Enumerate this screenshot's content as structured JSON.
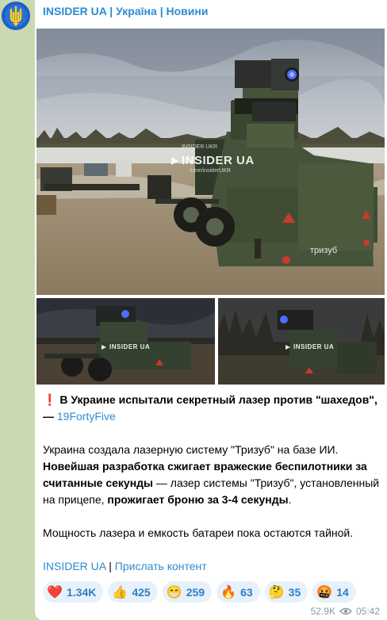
{
  "channel": {
    "header_name": "INSIDER UA",
    "header_tags": [
      "Україна",
      "Новини"
    ]
  },
  "media": {
    "watermark": "INSIDER UA",
    "watermark_top": "INSIDER UKR",
    "watermark_sub": "t.me/insiderUKR",
    "truck_label": "тризуб"
  },
  "post": {
    "headline": "В Украине испытали секретный лазер против \"шахедов\", —",
    "source_link": "19FortyFive",
    "p2_plain1": "Украина создала лазерную систему \"Тризуб\" на базе ИИ.",
    "p2_bold1": "Новейшая разработка сжигает вражеские беспилотники за считанные секунды",
    "p2_plain2": " — лазер системы \"Тризуб\", установленный на прицепе, ",
    "p2_bold2": "прожигает броню за 3-4 секунды",
    "p2_plain3": ".",
    "p3": "Мощность лазера и емкость батареи пока остаются тайной.",
    "footer_link1": "INSIDER UA",
    "footer_sep": "|",
    "footer_link2": "Прислать контент"
  },
  "reactions": [
    {
      "icon": "heart-icon",
      "emoji": "❤️",
      "count": "1.34K"
    },
    {
      "icon": "thumbs-up-icon",
      "emoji": "👍",
      "count": "425"
    },
    {
      "icon": "grin-face-icon",
      "emoji": "😁",
      "count": "259"
    },
    {
      "icon": "fire-icon",
      "emoji": "🔥",
      "count": "63"
    },
    {
      "icon": "thinking-face-icon",
      "emoji": "🤔",
      "count": "35"
    },
    {
      "icon": "angry-face-icon",
      "emoji": "🤬",
      "count": "14"
    }
  ],
  "meta": {
    "views": "52.9K",
    "time": "05:42"
  },
  "colors": {
    "link": "#2e8bd0",
    "background": "#c9d9b0",
    "reaction_bg": "#e6f1fb"
  }
}
